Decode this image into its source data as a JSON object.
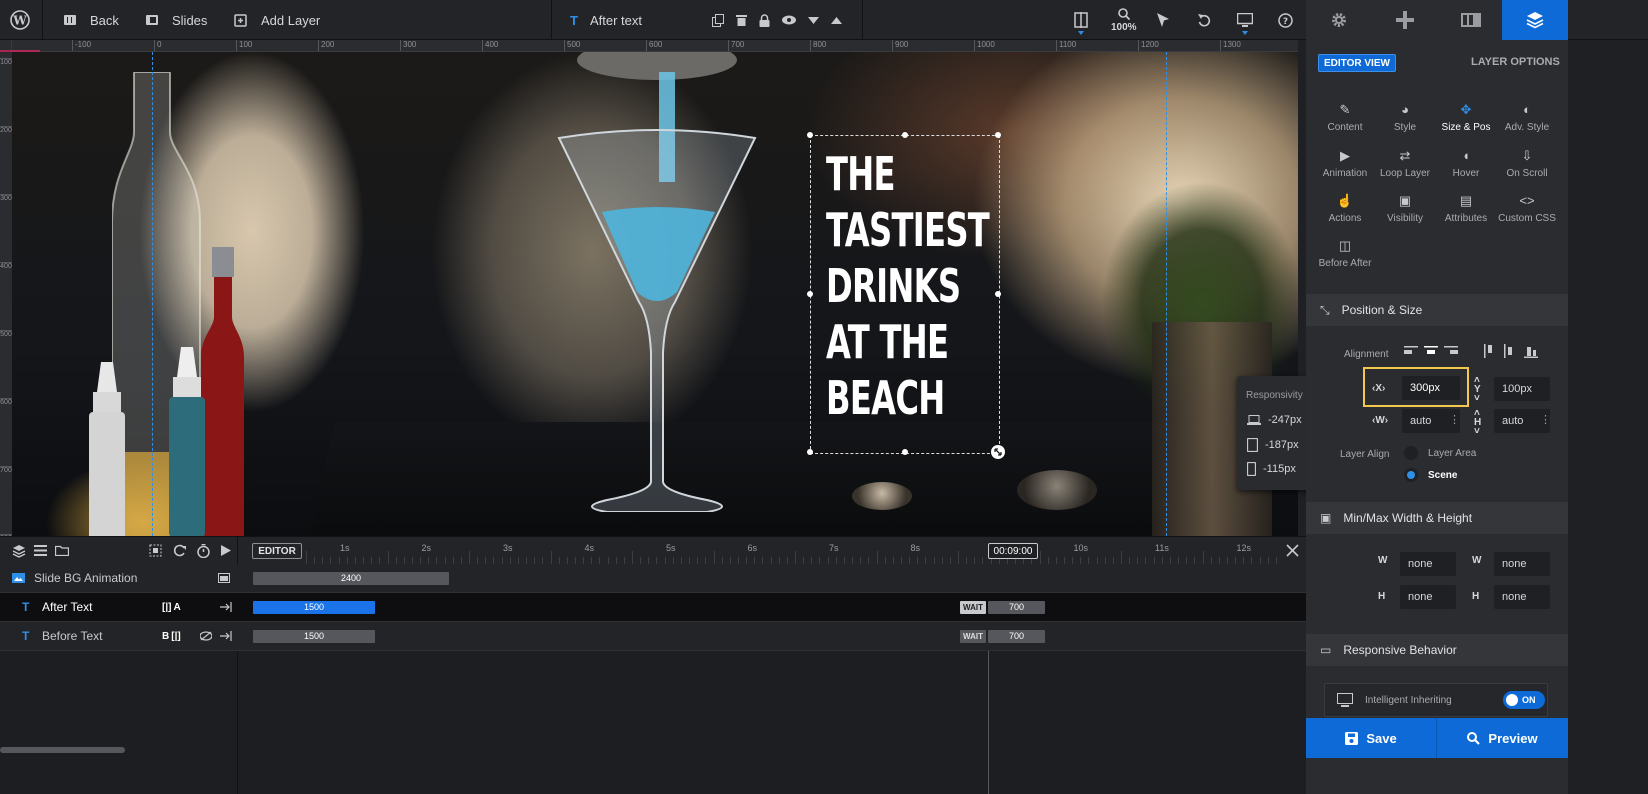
{
  "topbar": {
    "back_label": "Back",
    "slides_label": "Slides",
    "add_layer_label": "Add Layer",
    "current_layer": "After text",
    "zoom": "100%"
  },
  "ruler": {
    "top_ticks": [
      "-100",
      "0",
      "100",
      "200",
      "300",
      "400",
      "500",
      "600",
      "700",
      "800",
      "900",
      "1000",
      "1100",
      "1200",
      "1300",
      "14"
    ],
    "left_ticks": [
      "100",
      "200",
      "300",
      "400",
      "500",
      "600",
      "700",
      "800"
    ]
  },
  "slide": {
    "text": "THE\nTASTIEST\nDRINKS\nAT THE\nBEACH"
  },
  "responsivity": {
    "title": "Responsivity",
    "items": [
      {
        "icon": "laptop-icon",
        "value": "-247px"
      },
      {
        "icon": "tablet-icon",
        "value": "-187px"
      },
      {
        "icon": "phone-icon",
        "value": "-115px"
      }
    ]
  },
  "timeline": {
    "editor_label": "EDITOR",
    "time_marks": [
      "1s",
      "2s",
      "3s",
      "4s",
      "5s",
      "6s",
      "7s",
      "8s",
      "00:09:00",
      "10s",
      "11s",
      "12s"
    ],
    "rows": [
      {
        "name": "Slide BG Animation",
        "bar1": "2400"
      },
      {
        "name": "After Text",
        "badge": "A",
        "bar1": "1500",
        "wait": "WAIT",
        "bar2": "700"
      },
      {
        "name": "Before Text",
        "badge": "B",
        "bar1": "1500",
        "wait": "WAIT",
        "bar2": "700"
      }
    ]
  },
  "panel": {
    "editor_view": "EDITOR VIEW",
    "layer_options": "LAYER OPTIONS",
    "options": [
      "Content",
      "Style",
      "Size & Pos",
      "Adv. Style",
      "Animation",
      "Loop Layer",
      "Hover",
      "On Scroll",
      "Actions",
      "Visibility",
      "Attributes",
      "Custom CSS",
      "Before After"
    ],
    "position_size": {
      "title": "Position & Size",
      "alignment_label": "Alignment",
      "x_label": "X",
      "x_value": "300px",
      "y_label": "Y",
      "y_value": "100px",
      "w_label": "W",
      "w_value": "auto",
      "h_label": "H",
      "h_value": "auto",
      "layer_align_label": "Layer Align",
      "layer_area": "Layer Area",
      "scene": "Scene"
    },
    "minmax": {
      "title": "Min/Max Width & Height",
      "min_w": "none",
      "max_w": "none",
      "min_h": "none",
      "max_h": "none"
    },
    "responsive": {
      "title": "Responsive Behavior",
      "intelligent_inheriting": "Intelligent Inheriting",
      "toggle": "ON"
    },
    "save_label": "Save",
    "preview_label": "Preview"
  },
  "colors": {
    "accent": "#0d6ad6",
    "highlight": "#f2c94c",
    "timeline_blue": "#1a73e8"
  }
}
